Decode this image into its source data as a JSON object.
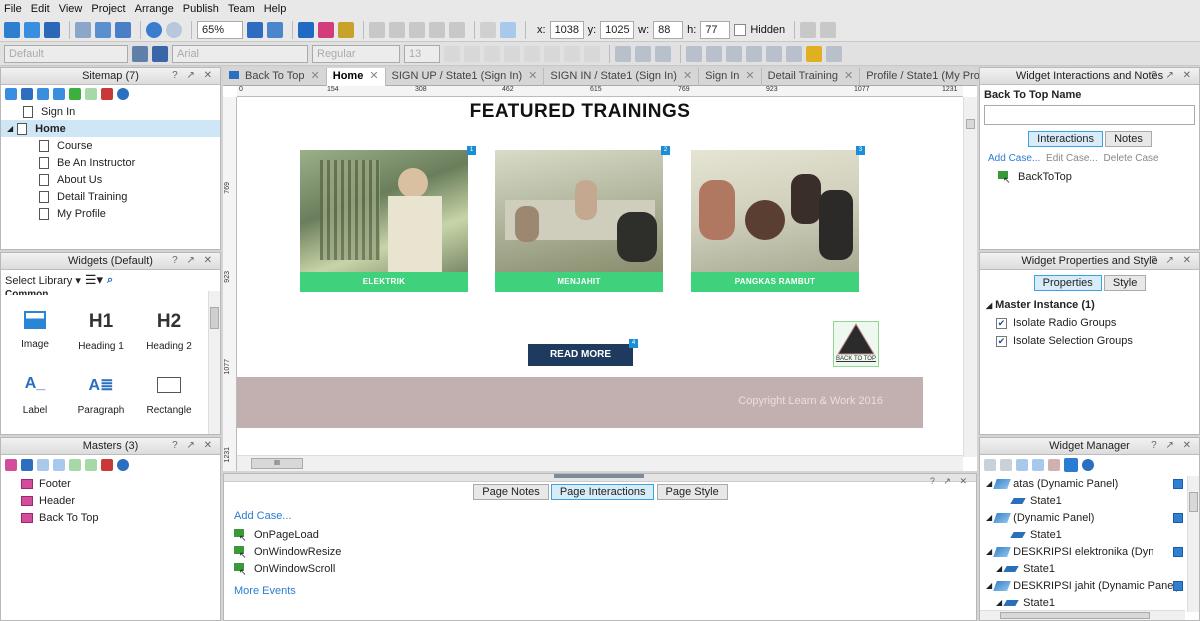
{
  "menu": [
    "File",
    "Edit",
    "View",
    "Project",
    "Arrange",
    "Publish",
    "Team",
    "Help"
  ],
  "toolbar": {
    "zoom": "65%",
    "x_label": "x:",
    "x_value": "1038",
    "y_label": "y:",
    "y_value": "1025",
    "w_label": "w:",
    "w_value": "88",
    "h_label": "h:",
    "h_value": "77",
    "hidden_label": "Hidden",
    "style_default": "Default",
    "font_family": "Arial",
    "font_weight": "Regular",
    "font_size": "13"
  },
  "sitemap": {
    "title": "Sitemap (7)",
    "pages": [
      {
        "label": "Sign In"
      },
      {
        "label": "Home"
      },
      {
        "label": "Course"
      },
      {
        "label": "Be An Instructor"
      },
      {
        "label": "About Us"
      },
      {
        "label": "Detail Training"
      },
      {
        "label": "My Profile"
      }
    ]
  },
  "widgets": {
    "title": "Widgets (Default)",
    "select_library": "Select Library",
    "group": "Common",
    "items": [
      "Image",
      "Heading 1",
      "Heading 2",
      "Label",
      "Paragraph",
      "Rectangle"
    ],
    "icons": [
      "H1",
      "H2"
    ]
  },
  "masters": {
    "title": "Masters (3)",
    "items": [
      "Footer",
      "Header",
      "Back To Top"
    ]
  },
  "tabs": [
    {
      "label": "Back To Top"
    },
    {
      "label": "Home"
    },
    {
      "label": "SIGN UP / State1 (Sign In)"
    },
    {
      "label": "SIGN IN / State1 (Sign In)"
    },
    {
      "label": "Sign In"
    },
    {
      "label": "Detail Training"
    },
    {
      "label": "Profile / State1 (My Profile)"
    }
  ],
  "ruler": {
    "top": [
      "0",
      "154",
      "308",
      "462",
      "615",
      "769",
      "923",
      "1077",
      "1231"
    ],
    "left": [
      "769",
      "923",
      "1077",
      "1231"
    ]
  },
  "design": {
    "heading": "FEATURED TRAININGS",
    "cards": [
      {
        "caption": "ELEKTRIK",
        "badge": "1"
      },
      {
        "caption": "MENJAHIT",
        "badge": "2"
      },
      {
        "caption": "PANGKAS RAMBUT",
        "badge": "3"
      }
    ],
    "read_more": "READ MORE",
    "read_more_badge": "4",
    "back_to_top": "BACK TO TOP",
    "footer_text": "Copyright Learn & Work 2016",
    "hscroll": "III"
  },
  "bottom_panel": {
    "tabs": [
      "Page Notes",
      "Page Interactions",
      "Page Style"
    ],
    "add_case": "Add Case...",
    "events": [
      "OnPageLoad",
      "OnWindowResize",
      "OnWindowScroll"
    ],
    "more_events": "More Events"
  },
  "interactions_panel": {
    "title": "Widget Interactions and Notes",
    "widget_name": "Back To Top Name",
    "tabs": [
      "Interactions",
      "Notes"
    ],
    "add_case": "Add Case...",
    "edit_case": "Edit Case...",
    "delete_case": "Delete Case",
    "case": "BackToTop"
  },
  "properties_panel": {
    "title": "Widget Properties and Style",
    "tabs": [
      "Properties",
      "Style"
    ],
    "section": "Master Instance (1)",
    "options": [
      "Isolate Radio Groups",
      "Isolate Selection Groups"
    ]
  },
  "widget_manager": {
    "title": "Widget Manager",
    "rows": [
      {
        "label": "atas (Dynamic Panel)",
        "type": "panel"
      },
      {
        "label": "State1",
        "type": "state"
      },
      {
        "label": "(Dynamic Panel)",
        "type": "panel"
      },
      {
        "label": "State1",
        "type": "state"
      },
      {
        "label": "DESKRIPSI elektronika (Dynamic Par",
        "type": "panel"
      },
      {
        "label": "State1",
        "type": "state"
      },
      {
        "label": "DESKRIPSI jahit (Dynamic Panel)",
        "type": "panel"
      },
      {
        "label": "State1",
        "type": "state"
      }
    ]
  },
  "colors": {
    "accent": "#1a8fd8",
    "card_caption": "#3fd17b",
    "read_more": "#1e3a5f",
    "footer": "#c2b0b0"
  }
}
